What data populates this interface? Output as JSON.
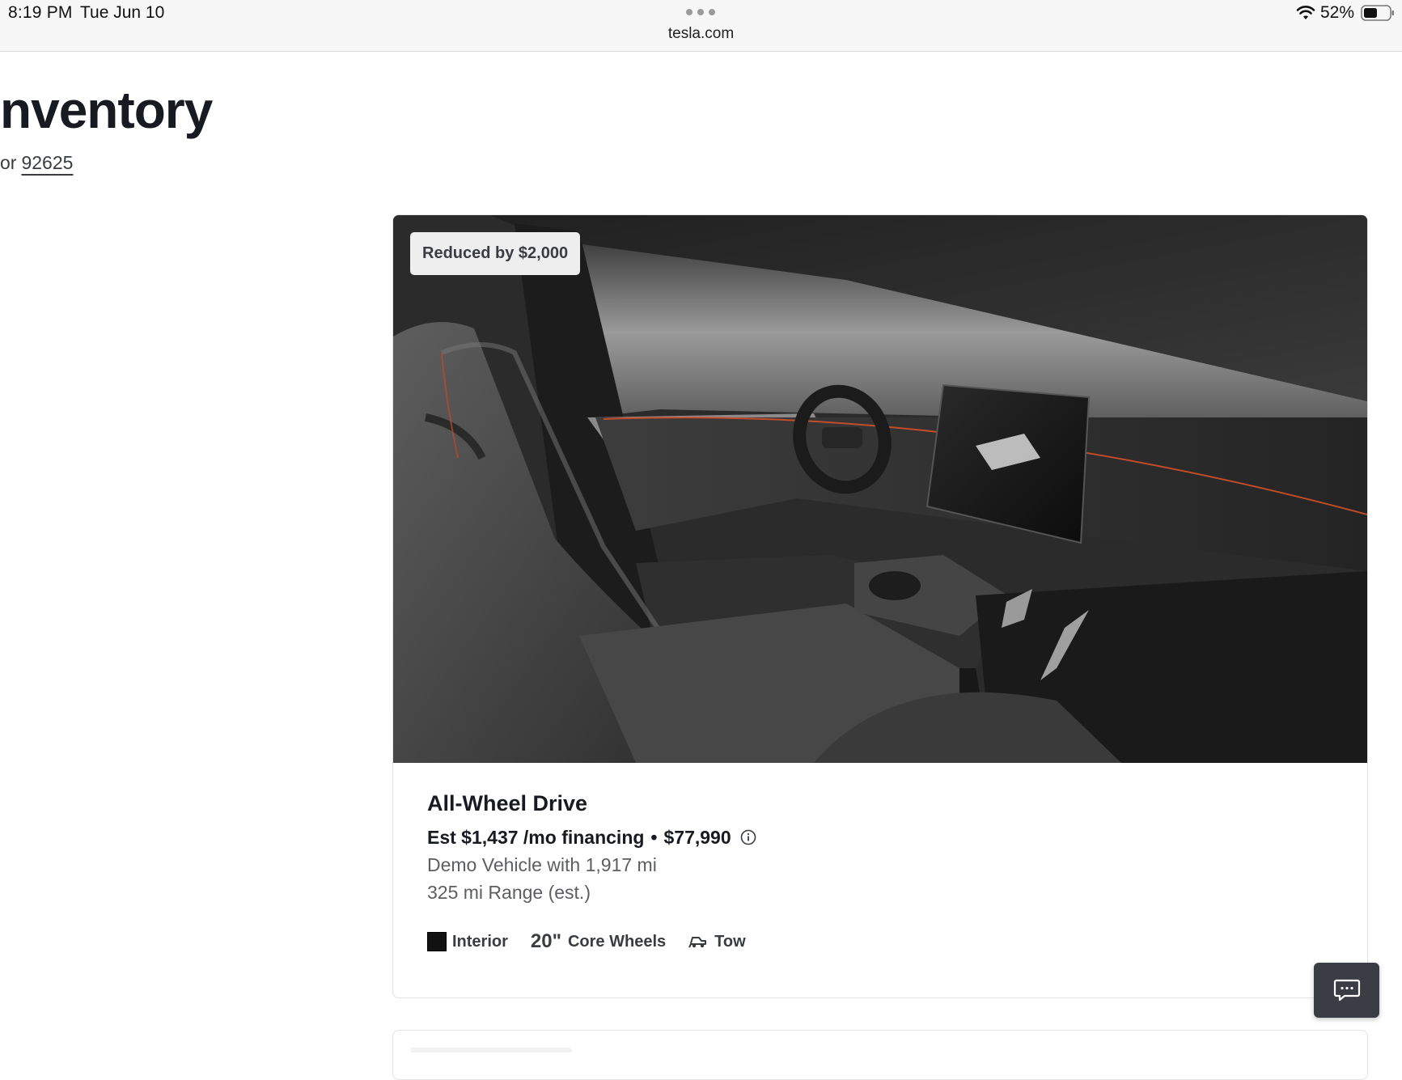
{
  "status_bar": {
    "time": "8:19 PM",
    "date": "Tue Jun 10",
    "battery": "52%"
  },
  "browser": {
    "url": "tesla.com"
  },
  "header": {
    "title": "nventory",
    "zip_prefix": "or",
    "zip": "92625"
  },
  "listing": {
    "badge": "Reduced by $2,000",
    "model": "All-Wheel Drive",
    "financing": "Est $1,437 /mo financing",
    "separator": "•",
    "price": "$77,990",
    "condition": "Demo Vehicle with 1,917 mi",
    "range": "325 mi Range (est.)",
    "features": {
      "interior_label": "Interior",
      "interior_color": "#111111",
      "wheel_size": "20\"",
      "wheels_label": "Core Wheels",
      "tow_label": "Tow"
    }
  },
  "icons": {
    "wifi": "wifi-icon",
    "battery": "battery-icon",
    "info": "info-icon",
    "tow": "tow-icon",
    "chat": "chat-icon"
  },
  "colors": {
    "text_primary": "#171a20",
    "text_secondary": "#5c5e62",
    "chat_bg": "#3a3d44",
    "accent_lighting": "#d2502a"
  }
}
